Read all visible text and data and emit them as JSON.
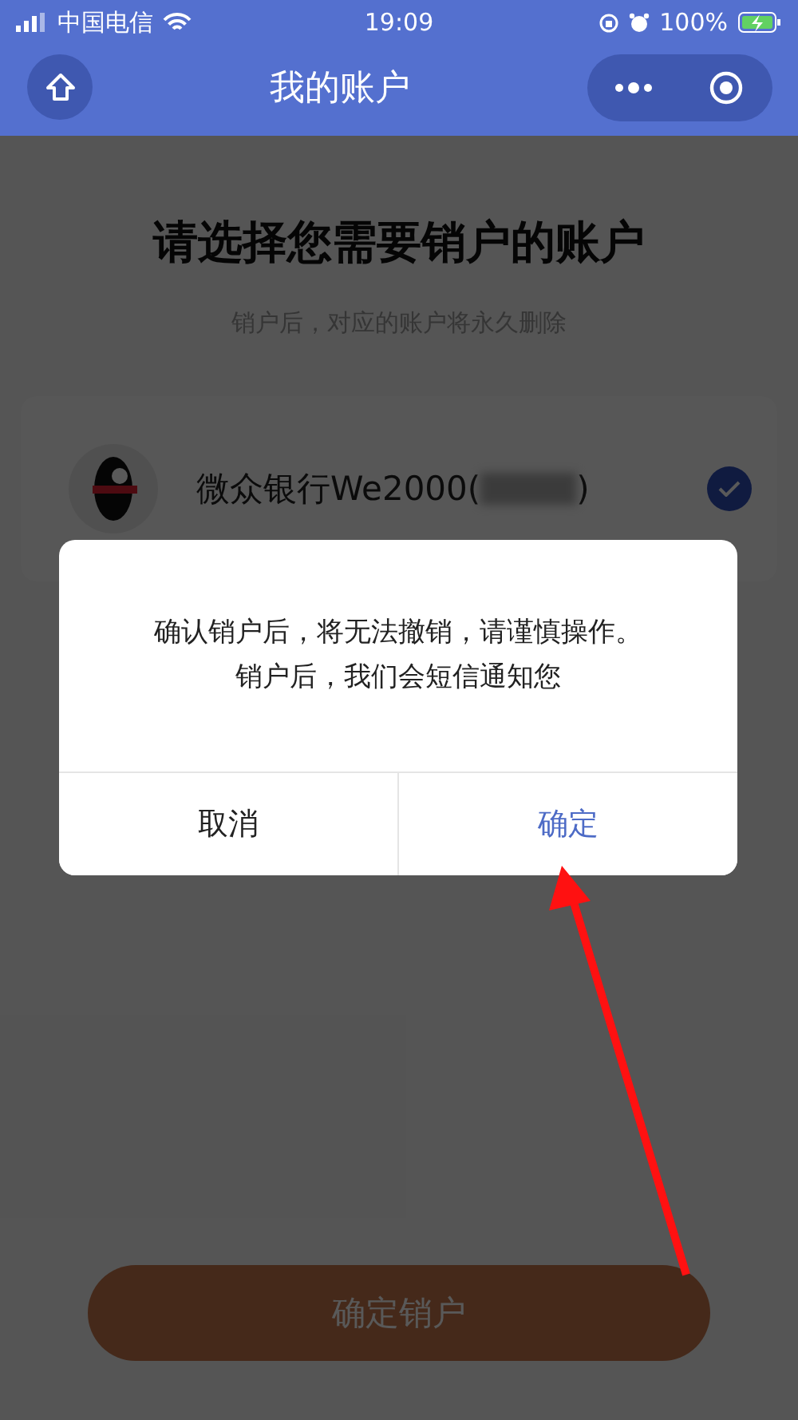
{
  "status_bar": {
    "carrier": "中国电信",
    "time": "19:09",
    "battery": "100%"
  },
  "header": {
    "title": "我的账户"
  },
  "page": {
    "title": "请选择您需要销户的账户",
    "subtitle": "销户后，对应的账户将永久删除",
    "accounts": [
      {
        "name": "微众银行We2000(",
        "name_end": ")",
        "selected": true
      }
    ],
    "submit_button": "确定销户"
  },
  "dialog": {
    "message": [
      "确认销户后，将无法撤销，请谨慎操作。",
      "销户后，我们会短信通知您"
    ],
    "buttons": [
      {
        "label": "取消",
        "kind": "cancel"
      },
      {
        "label": "确定",
        "kind": "confirm"
      }
    ]
  }
}
